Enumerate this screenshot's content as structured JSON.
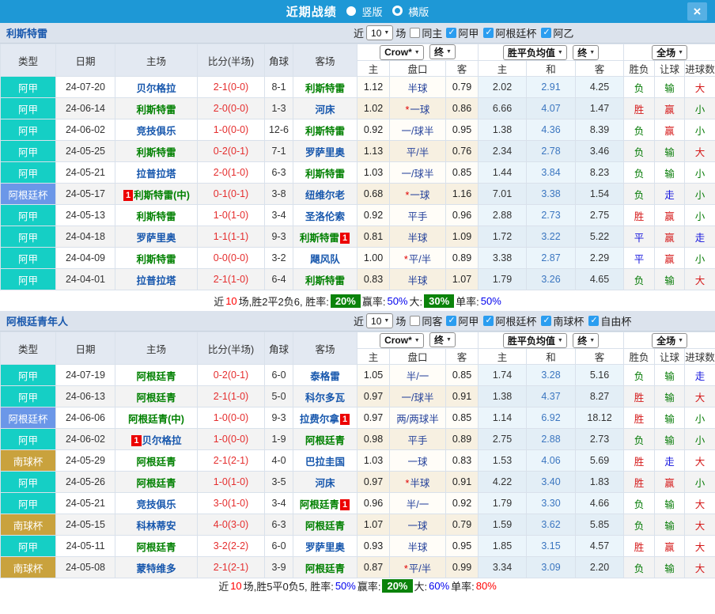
{
  "header": {
    "title": "近期战绩",
    "radios": [
      {
        "label": "竖版",
        "selected": true
      },
      {
        "label": "横版",
        "selected": false
      }
    ],
    "close_icon": "×"
  },
  "columns": [
    "类型",
    "日期",
    "主场",
    "比分(半场)",
    "角球",
    "客场",
    "主",
    "盘口",
    "客",
    "主",
    "和",
    "客",
    "胜负",
    "让球",
    "进球数"
  ],
  "red_badge_text": "1",
  "colors": {
    "titlebar": "#1e98d6",
    "league_badge_teal": "#15cfc5",
    "cup_badge_blue": "#6b97e8",
    "southcup_badge_gold": "#c9a23d",
    "team_highlight_green": "#008000",
    "score_red": "#e52e2e",
    "rate_badge_green": "#0b830b"
  },
  "sections": [
    {
      "team": "利斯特雷",
      "filters": {
        "near": "近",
        "count": "10",
        "suffix": "场",
        "same": {
          "label": "同主",
          "checked": false
        },
        "leagues": [
          {
            "label": "阿甲",
            "checked": true
          },
          {
            "label": "阿根廷杯",
            "checked": true
          },
          {
            "label": "阿乙",
            "checked": true
          }
        ]
      },
      "dropdowns": {
        "bookmaker": "Crow*",
        "bookmaker_time": "终",
        "avg": "胜平负均值",
        "avg_time": "终",
        "scope": "全场"
      },
      "rows": [
        {
          "type": "阿甲",
          "tc": "t1",
          "date": "24-07-20",
          "home": {
            "name": "贝尔格拉"
          },
          "score": "2-1(0-0)",
          "corner": "8-1",
          "away": {
            "name": "利斯特雷",
            "hl": true
          },
          "odds": [
            "1.12",
            "半球",
            "0.79"
          ],
          "star": false,
          "avg": [
            "2.02",
            "2.91",
            "4.25"
          ],
          "res": [
            [
              "负",
              "g"
            ],
            [
              "输",
              "g"
            ],
            [
              "大",
              "r"
            ]
          ]
        },
        {
          "type": "阿甲",
          "tc": "t1",
          "date": "24-06-14",
          "home": {
            "name": "利斯特雷",
            "hl": true
          },
          "score": "2-0(0-0)",
          "corner": "1-3",
          "away": {
            "name": "河床"
          },
          "odds": [
            "1.02",
            "一球",
            "0.86"
          ],
          "star": true,
          "avg": [
            "6.66",
            "4.07",
            "1.47"
          ],
          "res": [
            [
              "胜",
              "r"
            ],
            [
              "赢",
              "r"
            ],
            [
              "小",
              "g"
            ]
          ]
        },
        {
          "type": "阿甲",
          "tc": "t1",
          "date": "24-06-02",
          "home": {
            "name": "竞技俱乐"
          },
          "score": "1-0(0-0)",
          "corner": "12-6",
          "away": {
            "name": "利斯特雷",
            "hl": true
          },
          "odds": [
            "0.92",
            "一/球半",
            "0.95"
          ],
          "star": false,
          "avg": [
            "1.38",
            "4.36",
            "8.39"
          ],
          "res": [
            [
              "负",
              "g"
            ],
            [
              "赢",
              "r"
            ],
            [
              "小",
              "g"
            ]
          ]
        },
        {
          "type": "阿甲",
          "tc": "t1",
          "date": "24-05-25",
          "home": {
            "name": "利斯特雷",
            "hl": true
          },
          "score": "0-2(0-1)",
          "corner": "7-1",
          "away": {
            "name": "罗萨里奥"
          },
          "odds": [
            "1.13",
            "平/半",
            "0.76"
          ],
          "star": false,
          "avg": [
            "2.34",
            "2.78",
            "3.46"
          ],
          "res": [
            [
              "负",
              "g"
            ],
            [
              "输",
              "g"
            ],
            [
              "大",
              "r"
            ]
          ]
        },
        {
          "type": "阿甲",
          "tc": "t1",
          "date": "24-05-21",
          "home": {
            "name": "拉普拉塔"
          },
          "score": "2-0(1-0)",
          "corner": "6-3",
          "away": {
            "name": "利斯特雷",
            "hl": true
          },
          "odds": [
            "1.03",
            "一/球半",
            "0.85"
          ],
          "star": false,
          "avg": [
            "1.44",
            "3.84",
            "8.23"
          ],
          "res": [
            [
              "负",
              "g"
            ],
            [
              "输",
              "g"
            ],
            [
              "小",
              "g"
            ]
          ]
        },
        {
          "type": "阿根廷杯",
          "tc": "t2",
          "date": "24-05-17",
          "home": {
            "name": "利斯特雷(中)",
            "hl": true,
            "badge": "pre"
          },
          "score": "0-1(0-1)",
          "corner": "3-8",
          "away": {
            "name": "纽维尔老"
          },
          "odds": [
            "0.68",
            "一球",
            "1.16"
          ],
          "star": true,
          "avg": [
            "7.01",
            "3.38",
            "1.54"
          ],
          "res": [
            [
              "负",
              "g"
            ],
            [
              "走",
              "b"
            ],
            [
              "小",
              "g"
            ]
          ]
        },
        {
          "type": "阿甲",
          "tc": "t1",
          "date": "24-05-13",
          "home": {
            "name": "利斯特雷",
            "hl": true
          },
          "score": "1-0(1-0)",
          "corner": "3-4",
          "away": {
            "name": "圣洛伦索"
          },
          "odds": [
            "0.92",
            "平手",
            "0.96"
          ],
          "star": false,
          "avg": [
            "2.88",
            "2.73",
            "2.75"
          ],
          "res": [
            [
              "胜",
              "r"
            ],
            [
              "赢",
              "r"
            ],
            [
              "小",
              "g"
            ]
          ]
        },
        {
          "type": "阿甲",
          "tc": "t1",
          "date": "24-04-18",
          "home": {
            "name": "罗萨里奥"
          },
          "score": "1-1(1-1)",
          "corner": "9-3",
          "away": {
            "name": "利斯特雷",
            "hl": true,
            "badge": "post"
          },
          "odds": [
            "0.81",
            "半球",
            "1.09"
          ],
          "star": false,
          "avg": [
            "1.72",
            "3.22",
            "5.22"
          ],
          "res": [
            [
              "平",
              "b"
            ],
            [
              "赢",
              "r"
            ],
            [
              "走",
              "b"
            ]
          ]
        },
        {
          "type": "阿甲",
          "tc": "t1",
          "date": "24-04-09",
          "home": {
            "name": "利斯特雷",
            "hl": true
          },
          "score": "0-0(0-0)",
          "corner": "3-2",
          "away": {
            "name": "飓风队"
          },
          "odds": [
            "1.00",
            "平/半",
            "0.89"
          ],
          "star": true,
          "avg": [
            "3.38",
            "2.87",
            "2.29"
          ],
          "res": [
            [
              "平",
              "b"
            ],
            [
              "赢",
              "r"
            ],
            [
              "小",
              "g"
            ]
          ]
        },
        {
          "type": "阿甲",
          "tc": "t1",
          "date": "24-04-01",
          "home": {
            "name": "拉普拉塔"
          },
          "score": "2-1(1-0)",
          "corner": "6-4",
          "away": {
            "name": "利斯特雷",
            "hl": true
          },
          "odds": [
            "0.83",
            "半球",
            "1.07"
          ],
          "star": false,
          "avg": [
            "1.79",
            "3.26",
            "4.65"
          ],
          "res": [
            [
              "负",
              "g"
            ],
            [
              "输",
              "g"
            ],
            [
              "大",
              "r"
            ]
          ]
        }
      ],
      "summary": [
        {
          "t": "近",
          "c": "k"
        },
        {
          "t": "10",
          "c": "r"
        },
        {
          "t": "场,胜2平2负6, 胜率:",
          "c": "k"
        },
        {
          "t": "20%",
          "c": "badge"
        },
        {
          "t": "赢率:",
          "c": "k"
        },
        {
          "t": "50%",
          "c": "b"
        },
        {
          "t": " 大:",
          "c": "k"
        },
        {
          "t": "30%",
          "c": "badge"
        },
        {
          "t": "单率:",
          "c": "k"
        },
        {
          "t": "50%",
          "c": "b"
        }
      ]
    },
    {
      "team": "阿根廷青年人",
      "filters": {
        "near": "近",
        "count": "10",
        "suffix": "场",
        "same": {
          "label": "同客",
          "checked": false
        },
        "leagues": [
          {
            "label": "阿甲",
            "checked": true
          },
          {
            "label": "阿根廷杯",
            "checked": true
          },
          {
            "label": "南球杯",
            "checked": true
          },
          {
            "label": "自由杯",
            "checked": true
          }
        ]
      },
      "dropdowns": {
        "bookmaker": "Crow*",
        "bookmaker_time": "终",
        "avg": "胜平负均值",
        "avg_time": "终",
        "scope": "全场"
      },
      "rows": [
        {
          "type": "阿甲",
          "tc": "t1",
          "date": "24-07-19",
          "home": {
            "name": "阿根廷青",
            "hl": true
          },
          "score": "0-2(0-1)",
          "corner": "6-0",
          "away": {
            "name": "泰格雷"
          },
          "odds": [
            "1.05",
            "半/一",
            "0.85"
          ],
          "star": false,
          "avg": [
            "1.74",
            "3.28",
            "5.16"
          ],
          "res": [
            [
              "负",
              "g"
            ],
            [
              "输",
              "g"
            ],
            [
              "走",
              "b"
            ]
          ]
        },
        {
          "type": "阿甲",
          "tc": "t1",
          "date": "24-06-13",
          "home": {
            "name": "阿根廷青",
            "hl": true
          },
          "score": "2-1(1-0)",
          "corner": "5-0",
          "away": {
            "name": "科尔多瓦"
          },
          "odds": [
            "0.97",
            "一/球半",
            "0.91"
          ],
          "star": false,
          "avg": [
            "1.38",
            "4.37",
            "8.27"
          ],
          "res": [
            [
              "胜",
              "r"
            ],
            [
              "输",
              "g"
            ],
            [
              "大",
              "r"
            ]
          ]
        },
        {
          "type": "阿根廷杯",
          "tc": "t2",
          "date": "24-06-06",
          "home": {
            "name": "阿根廷青(中)",
            "hl": true
          },
          "score": "1-0(0-0)",
          "corner": "9-3",
          "away": {
            "name": "拉费尔拿",
            "badge": "post"
          },
          "odds": [
            "0.97",
            "两/两球半",
            "0.85"
          ],
          "star": false,
          "avg": [
            "1.14",
            "6.92",
            "18.12"
          ],
          "res": [
            [
              "胜",
              "r"
            ],
            [
              "输",
              "g"
            ],
            [
              "小",
              "g"
            ]
          ]
        },
        {
          "type": "阿甲",
          "tc": "t1",
          "date": "24-06-02",
          "home": {
            "name": "贝尔格拉",
            "badge": "pre"
          },
          "score": "1-0(0-0)",
          "corner": "1-9",
          "away": {
            "name": "阿根廷青",
            "hl": true
          },
          "odds": [
            "0.98",
            "平手",
            "0.89"
          ],
          "star": false,
          "avg": [
            "2.75",
            "2.88",
            "2.73"
          ],
          "res": [
            [
              "负",
              "g"
            ],
            [
              "输",
              "g"
            ],
            [
              "小",
              "g"
            ]
          ]
        },
        {
          "type": "南球杯",
          "tc": "t3",
          "date": "24-05-29",
          "home": {
            "name": "阿根廷青",
            "hl": true
          },
          "score": "2-1(2-1)",
          "corner": "4-0",
          "away": {
            "name": "巴拉圭国"
          },
          "odds": [
            "1.03",
            "一球",
            "0.83"
          ],
          "star": false,
          "avg": [
            "1.53",
            "4.06",
            "5.69"
          ],
          "res": [
            [
              "胜",
              "r"
            ],
            [
              "走",
              "b"
            ],
            [
              "大",
              "r"
            ]
          ]
        },
        {
          "type": "阿甲",
          "tc": "t1",
          "date": "24-05-26",
          "home": {
            "name": "阿根廷青",
            "hl": true
          },
          "score": "1-0(1-0)",
          "corner": "3-5",
          "away": {
            "name": "河床"
          },
          "odds": [
            "0.97",
            "半球",
            "0.91"
          ],
          "star": true,
          "avg": [
            "4.22",
            "3.40",
            "1.83"
          ],
          "res": [
            [
              "胜",
              "r"
            ],
            [
              "赢",
              "r"
            ],
            [
              "小",
              "g"
            ]
          ]
        },
        {
          "type": "阿甲",
          "tc": "t1",
          "date": "24-05-21",
          "home": {
            "name": "竞技俱乐"
          },
          "score": "3-0(1-0)",
          "corner": "3-4",
          "away": {
            "name": "阿根廷青",
            "hl": true,
            "badge": "post"
          },
          "odds": [
            "0.96",
            "半/一",
            "0.92"
          ],
          "star": false,
          "avg": [
            "1.79",
            "3.30",
            "4.66"
          ],
          "res": [
            [
              "负",
              "g"
            ],
            [
              "输",
              "g"
            ],
            [
              "大",
              "r"
            ]
          ]
        },
        {
          "type": "南球杯",
          "tc": "t3",
          "date": "24-05-15",
          "home": {
            "name": "科林蒂安"
          },
          "score": "4-0(3-0)",
          "corner": "6-3",
          "away": {
            "name": "阿根廷青",
            "hl": true
          },
          "odds": [
            "1.07",
            "一球",
            "0.79"
          ],
          "star": false,
          "avg": [
            "1.59",
            "3.62",
            "5.85"
          ],
          "res": [
            [
              "负",
              "g"
            ],
            [
              "输",
              "g"
            ],
            [
              "大",
              "r"
            ]
          ]
        },
        {
          "type": "阿甲",
          "tc": "t1",
          "date": "24-05-11",
          "home": {
            "name": "阿根廷青",
            "hl": true
          },
          "score": "3-2(2-2)",
          "corner": "6-0",
          "away": {
            "name": "罗萨里奥"
          },
          "odds": [
            "0.93",
            "半球",
            "0.95"
          ],
          "star": false,
          "avg": [
            "1.85",
            "3.15",
            "4.57"
          ],
          "res": [
            [
              "胜",
              "r"
            ],
            [
              "赢",
              "r"
            ],
            [
              "大",
              "r"
            ]
          ]
        },
        {
          "type": "南球杯",
          "tc": "t3",
          "date": "24-05-08",
          "home": {
            "name": "蒙特维多"
          },
          "score": "2-1(2-1)",
          "corner": "3-9",
          "away": {
            "name": "阿根廷青",
            "hl": true
          },
          "odds": [
            "0.87",
            "平/半",
            "0.99"
          ],
          "star": true,
          "avg": [
            "3.34",
            "3.09",
            "2.20"
          ],
          "res": [
            [
              "负",
              "g"
            ],
            [
              "输",
              "g"
            ],
            [
              "大",
              "r"
            ]
          ]
        }
      ],
      "summary": [
        {
          "t": "近",
          "c": "k"
        },
        {
          "t": "10",
          "c": "r"
        },
        {
          "t": "场,胜5平0负5, 胜率:",
          "c": "k"
        },
        {
          "t": "50%",
          "c": "b"
        },
        {
          "t": " 赢率:",
          "c": "k"
        },
        {
          "t": "20%",
          "c": "badge"
        },
        {
          "t": " 大:",
          "c": "k"
        },
        {
          "t": "60%",
          "c": "b"
        },
        {
          "t": " 单率:",
          "c": "k"
        },
        {
          "t": "80%",
          "c": "r"
        }
      ]
    }
  ]
}
